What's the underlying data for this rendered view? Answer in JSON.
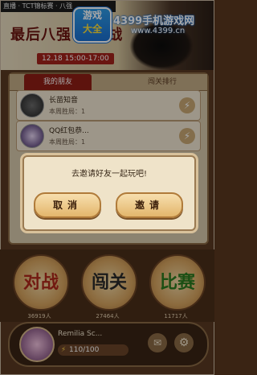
{
  "banner": {
    "marquee": "直播 · TCT锦标赛 · 八强",
    "title": "最后八强 大决战",
    "date": "12.18 15:00-17:00"
  },
  "watermark": {
    "logo_top": "游戏",
    "logo_bottom": "大全",
    "site_name": "4399手机游戏网",
    "url": "www.4399.cn"
  },
  "tabs": {
    "friends": "我的朋友",
    "ranking": "闯关排行"
  },
  "friends": [
    {
      "name": "长苗知音",
      "stat": "本周胜局：1"
    },
    {
      "name": "QQ红包恭...",
      "stat": "本周胜局：1"
    }
  ],
  "dialog": {
    "message": "去邀请好友一起玩吧!",
    "cancel_label": "取消",
    "confirm_label": "邀请"
  },
  "modes": [
    {
      "label": "对战",
      "count": "36919人"
    },
    {
      "label": "闯关",
      "count": "27464人"
    },
    {
      "label": "比赛",
      "count": "11717人"
    }
  ],
  "profile": {
    "name": "Remilia Sc...",
    "energy": "110/100"
  },
  "icons": {
    "bolt": "lightning-icon",
    "mail": "mail-icon",
    "gear": "gear-icon"
  }
}
